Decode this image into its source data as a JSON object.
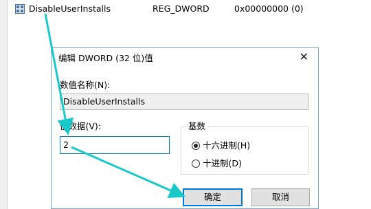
{
  "registry": {
    "value_name": "DisableUserInstalls",
    "value_type": "REG_DWORD",
    "value_data": "0x00000000 (0)",
    "icon": "registry-value-icon"
  },
  "dialog": {
    "title": "编辑 DWORD (32 位)值",
    "close_icon": "close-icon",
    "name_label": "数值名称(N):",
    "name_value": "DisableUserInstalls",
    "value_label": "值数据(V):",
    "value_input": "2",
    "base_label": "基数",
    "radio_hex": "十六进制(H)",
    "radio_dec": "十进制(D)",
    "selected_base": "hex",
    "ok_label": "确定",
    "cancel_label": "取消"
  },
  "annotations": {
    "arrow_color": "#19c9c9"
  }
}
